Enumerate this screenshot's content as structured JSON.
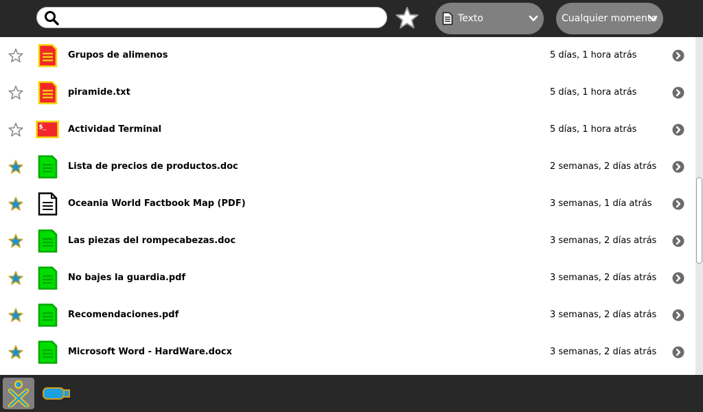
{
  "search": {
    "value": "",
    "placeholder": ""
  },
  "filters": {
    "type_label": "Texto",
    "time_label": "Cualquier momento"
  },
  "entries": [
    {
      "title": "Grupos de alimenos",
      "date": "5 días, 1 hora atrás",
      "favorite": false,
      "icon": "text-document-icon"
    },
    {
      "title": "piramide.txt",
      "date": "5 días, 1 hora atrás",
      "favorite": false,
      "icon": "text-document-icon"
    },
    {
      "title": "Actividad Terminal",
      "date": "5 días, 1 hora atrás",
      "favorite": false,
      "icon": "terminal-icon"
    },
    {
      "title": "Lista de precios de productos.doc",
      "date": "2 semanas, 2 días atrás",
      "favorite": true,
      "icon": "text-document-icon"
    },
    {
      "title": "Oceania World Factbook Map (PDF)",
      "date": "3 semanas, 1 día atrás",
      "favorite": true,
      "icon": "document-outline-icon"
    },
    {
      "title": "Las piezas del rompecabezas.doc",
      "date": "3 semanas, 2 días atrás",
      "favorite": true,
      "icon": "text-document-icon"
    },
    {
      "title": "No bajes la guardia.pdf",
      "date": "3 semanas, 2 días atrás",
      "favorite": true,
      "icon": "text-document-icon"
    },
    {
      "title": "Recomendaciones.pdf",
      "date": "3 semanas, 2 días atrás",
      "favorite": true,
      "icon": "text-document-icon"
    },
    {
      "title": "Microsoft Word - HardWare.docx",
      "date": "3 semanas, 2 días atrás",
      "favorite": true,
      "icon": "text-document-icon"
    }
  ],
  "colors": {
    "toolbar_bg": "#282828",
    "combo_bg": "#808080",
    "favorite_fill": "#1b8fd1",
    "favorite_stroke": "#c9a623",
    "owner_red_fill": "#f2272a",
    "owner_red_stroke": "#f5d40a",
    "owner_green_fill": "#00de00",
    "owner_green_stroke": "#00a800",
    "xo_fill": "#1e9fe0",
    "xo_stroke": "#f0c419"
  }
}
